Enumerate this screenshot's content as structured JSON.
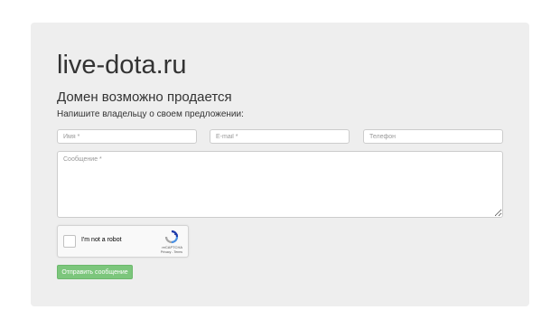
{
  "header": {
    "site_title": "live-dota.ru",
    "subtitle": "Домен возможно продается",
    "prompt": "Напишите владельцу о своем предложении:"
  },
  "form": {
    "name_placeholder": "Имя *",
    "email_placeholder": "E-mail *",
    "phone_placeholder": "Телефон",
    "message_placeholder": "Сообщение *",
    "submit_label": "Отправить сообщение"
  },
  "captcha": {
    "label": "I'm not a robot",
    "brand": "reCAPTCHA",
    "privacy": "Privacy",
    "separator": " - ",
    "terms": "Terms",
    "icon": "recaptcha-logo-icon"
  },
  "colors": {
    "panel_bg": "#eeeeee",
    "submit_bg": "#7cc67c",
    "text": "#333333"
  }
}
